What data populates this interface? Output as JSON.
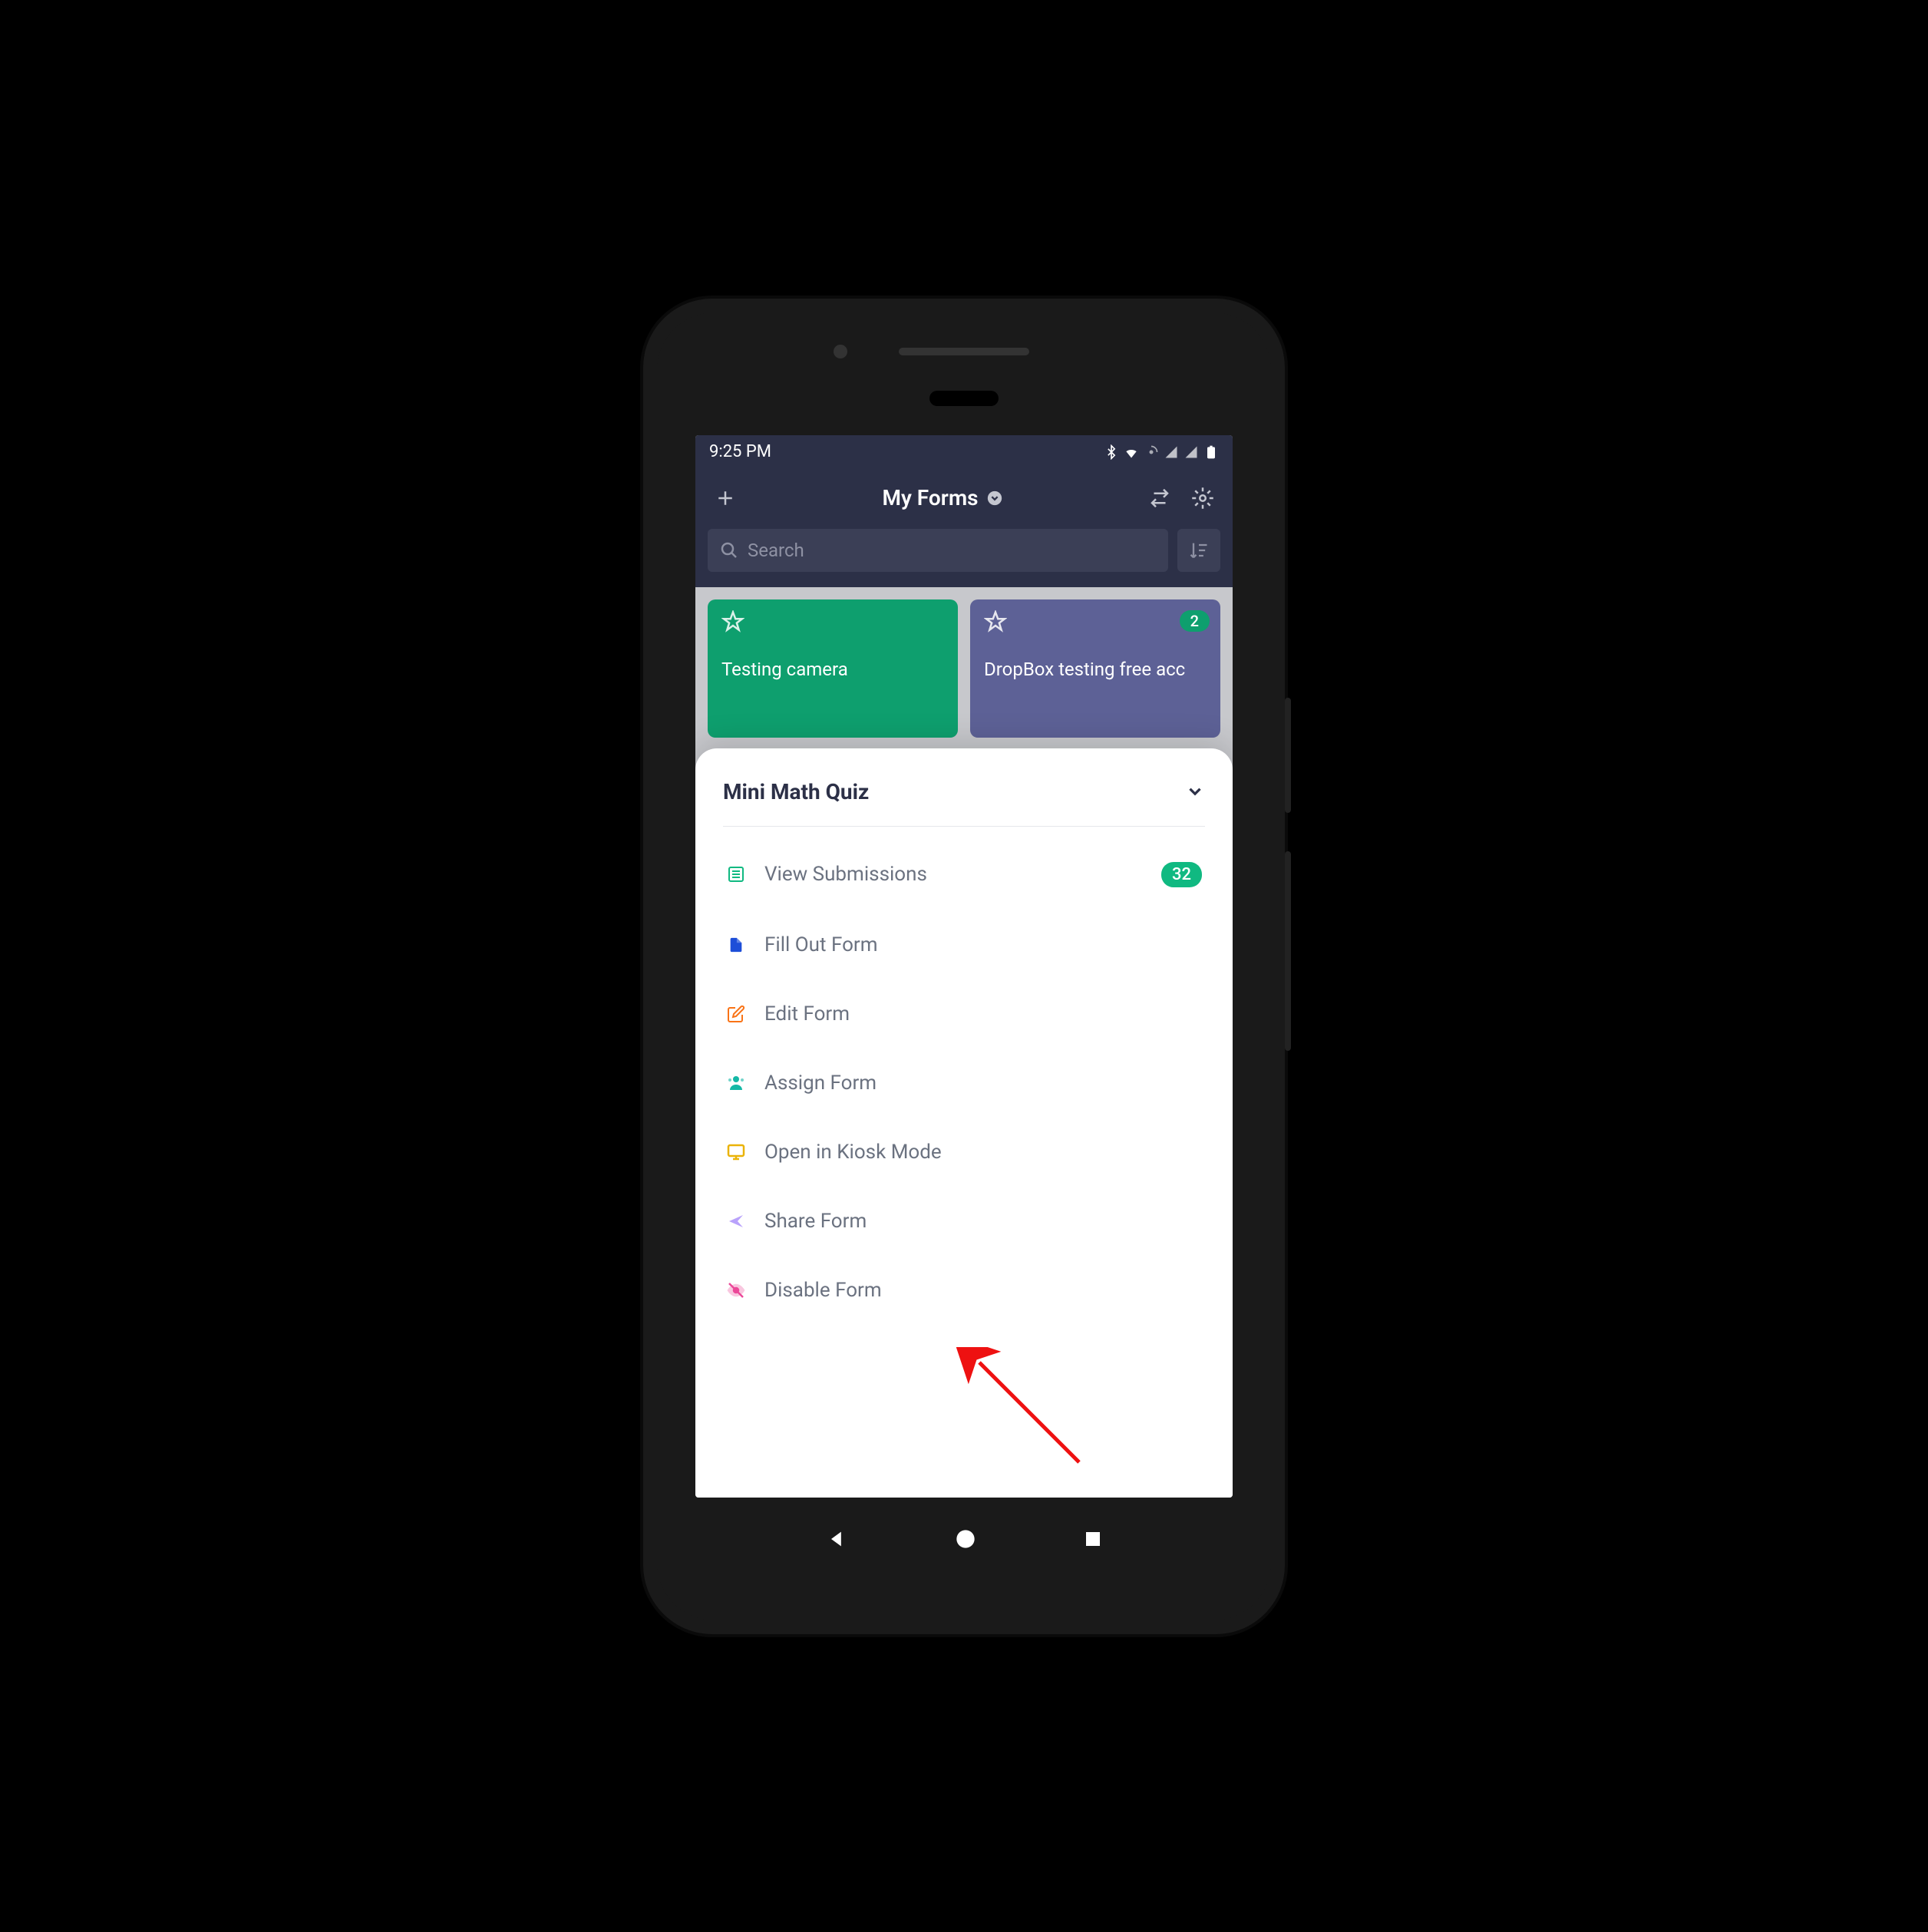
{
  "status": {
    "time": "9:25 PM"
  },
  "header": {
    "title": "My Forms"
  },
  "search": {
    "placeholder": "Search"
  },
  "cards": [
    {
      "title": "Testing camera",
      "badge": null
    },
    {
      "title": "DropBox testing free acc",
      "badge": "2"
    }
  ],
  "sheet": {
    "title": "Mini Math Quiz",
    "items": [
      {
        "label": "View Submissions",
        "badge": "32",
        "iconColor": "#10b981"
      },
      {
        "label": "Fill Out Form",
        "badge": null,
        "iconColor": "#1d4ed8"
      },
      {
        "label": "Edit Form",
        "badge": null,
        "iconColor": "#f97316"
      },
      {
        "label": "Assign Form",
        "badge": null,
        "iconColor": "#14b8a6"
      },
      {
        "label": "Open in Kiosk Mode",
        "badge": null,
        "iconColor": "#eab308"
      },
      {
        "label": "Share Form",
        "badge": null,
        "iconColor": "#a78bfa"
      },
      {
        "label": "Disable Form",
        "badge": null,
        "iconColor": "#ec4899"
      }
    ]
  }
}
